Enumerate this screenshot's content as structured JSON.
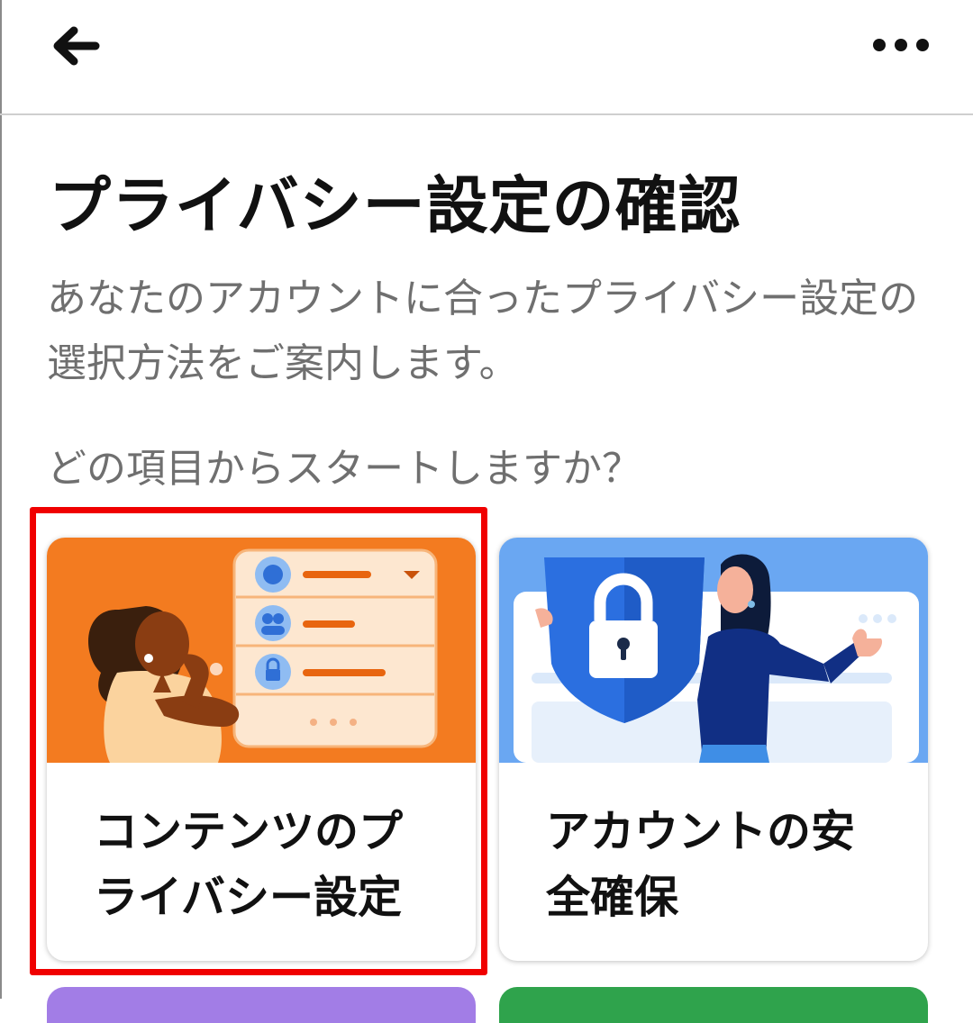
{
  "header": {
    "back_icon": "arrow-left-icon",
    "more_icon": "more-horizontal-icon"
  },
  "page": {
    "title": "プライバシー設定の確認",
    "description": "あなたのアカウントに合ったプライバシー設定の選択方法をご案内します。",
    "question": "どの項目からスタートしますか？"
  },
  "cards": [
    {
      "label": "コンテンツのプライバシー設定",
      "accent": "#f37b20",
      "illustration": "woman-with-privacy-settings-list"
    },
    {
      "label": "アカウントの安全確保",
      "accent": "#6aa7f2",
      "illustration": "woman-with-shield-lock"
    }
  ],
  "colors": {
    "highlight": "#f00000",
    "peek_purple": "#a27de6",
    "peek_green": "#2fa34c"
  }
}
